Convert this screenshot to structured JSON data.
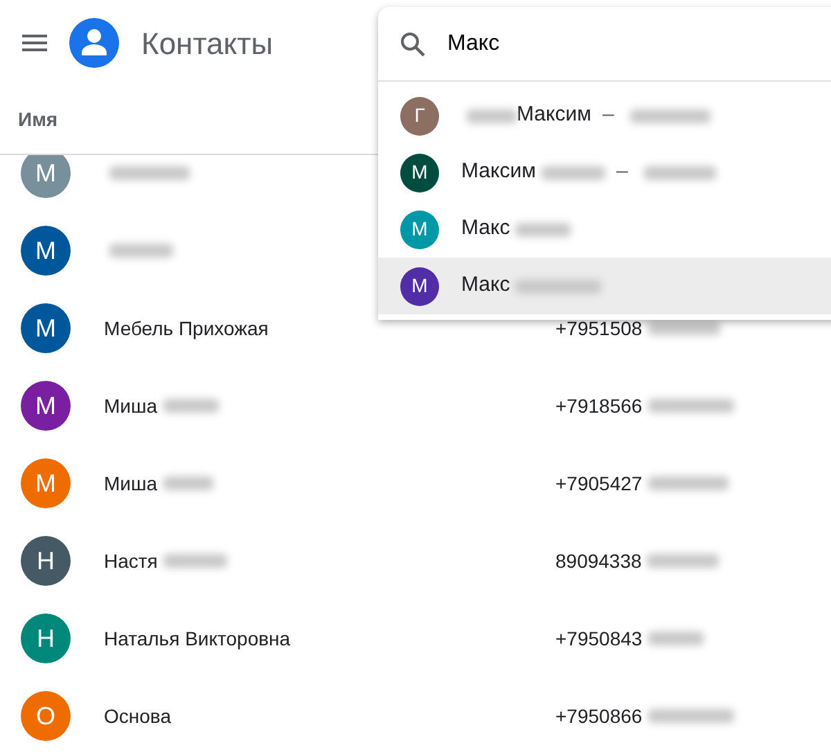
{
  "app": {
    "title": "Контакты"
  },
  "search": {
    "value": "Макс"
  },
  "suggestions": [
    {
      "letter": "Г",
      "color": "#8d6e63",
      "selected": false,
      "segments": [
        {
          "kind": "blur"
        },
        {
          "kind": "text",
          "text": "Максим"
        },
        {
          "kind": "dash",
          "text": "–"
        },
        {
          "kind": "blur"
        }
      ]
    },
    {
      "letter": "М",
      "color": "#004d40",
      "selected": false,
      "segments": [
        {
          "kind": "text",
          "text": "Максим"
        },
        {
          "kind": "blur"
        },
        {
          "kind": "dash",
          "text": "–"
        },
        {
          "kind": "blur"
        }
      ]
    },
    {
      "letter": "М",
      "color": "#0097a7",
      "selected": false,
      "segments": [
        {
          "kind": "text",
          "text": "Макс"
        },
        {
          "kind": "blur"
        }
      ]
    },
    {
      "letter": "М",
      "color": "#512da8",
      "selected": true,
      "segments": [
        {
          "kind": "text",
          "text": "Макс"
        },
        {
          "kind": "blur"
        }
      ]
    }
  ],
  "table": {
    "columns": [
      "Имя"
    ],
    "rows": [
      {
        "letter": "М",
        "color": "#78909c",
        "name": [
          {
            "kind": "blur"
          }
        ]
      },
      {
        "letter": "М",
        "color": "#01579b",
        "name": [
          {
            "kind": "blur"
          }
        ]
      },
      {
        "letter": "М",
        "color": "#01579b",
        "name": [
          {
            "kind": "text",
            "text": "Мебель Прихожая"
          }
        ],
        "phone": [
          {
            "kind": "text",
            "text": "+7951508"
          },
          {
            "kind": "blur"
          }
        ]
      },
      {
        "letter": "М",
        "color": "#7b1fa2",
        "name": [
          {
            "kind": "text",
            "text": "Миша"
          },
          {
            "kind": "blur"
          }
        ],
        "phone": [
          {
            "kind": "text",
            "text": "+7918566"
          },
          {
            "kind": "blur"
          }
        ]
      },
      {
        "letter": "М",
        "color": "#ef6c00",
        "name": [
          {
            "kind": "text",
            "text": "Миша"
          },
          {
            "kind": "blur"
          }
        ],
        "phone": [
          {
            "kind": "text",
            "text": "+7905427"
          },
          {
            "kind": "blur"
          }
        ]
      },
      {
        "letter": "Н",
        "color": "#455a64",
        "name": [
          {
            "kind": "text",
            "text": "Настя"
          },
          {
            "kind": "blur"
          }
        ],
        "phone": [
          {
            "kind": "text",
            "text": "89094338"
          },
          {
            "kind": "blur"
          }
        ]
      },
      {
        "letter": "Н",
        "color": "#00897b",
        "name": [
          {
            "kind": "text",
            "text": "Наталья Викторовна"
          }
        ],
        "phone": [
          {
            "kind": "text",
            "text": "+7950843"
          },
          {
            "kind": "blur"
          }
        ]
      },
      {
        "letter": "О",
        "color": "#ef6c00",
        "name": [
          {
            "kind": "text",
            "text": "Основа"
          }
        ],
        "phone": [
          {
            "kind": "text",
            "text": "+7950866"
          },
          {
            "kind": "blur"
          }
        ]
      }
    ]
  }
}
